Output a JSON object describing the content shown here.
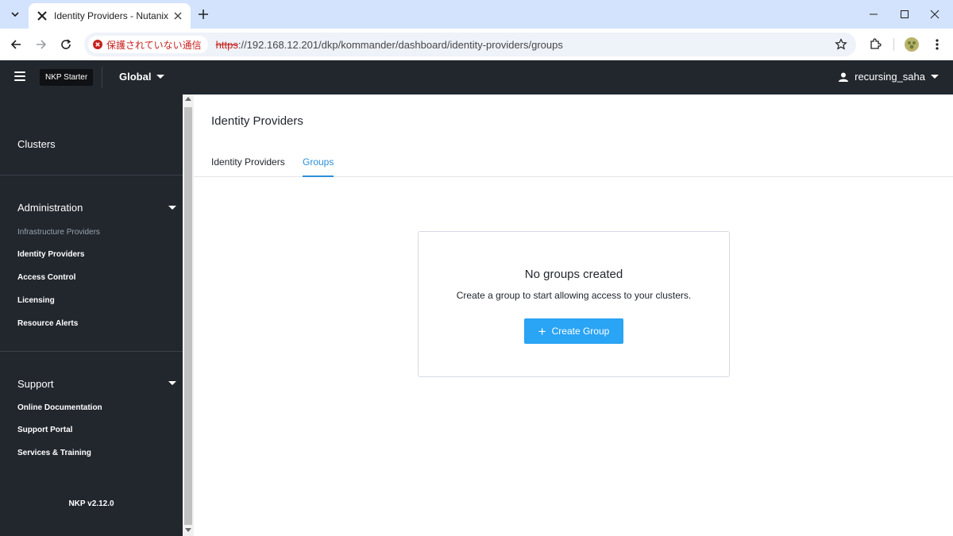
{
  "browser": {
    "tab_title": "Identity Providers - Nutanix NKP",
    "security_label": "保護されていない通信",
    "url_scheme": "https",
    "url_rest": "://192.168.12.201/dkp/kommander/dashboard/identity-providers/groups"
  },
  "header": {
    "brand": "NKP Starter",
    "scope": "Global",
    "username": "recursing_saha"
  },
  "sidebar": {
    "clusters_label": "Clusters",
    "administration": {
      "title": "Administration",
      "items": [
        {
          "label": "Infrastructure Providers"
        },
        {
          "label": "Identity Providers"
        },
        {
          "label": "Access Control"
        },
        {
          "label": "Licensing"
        },
        {
          "label": "Resource Alerts"
        }
      ]
    },
    "support": {
      "title": "Support",
      "items": [
        {
          "label": "Online Documentation"
        },
        {
          "label": "Support Portal"
        },
        {
          "label": "Services & Training"
        }
      ]
    },
    "version": "NKP v2.12.0"
  },
  "main": {
    "title": "Identity Providers",
    "tabs": [
      {
        "label": "Identity Providers",
        "active": false
      },
      {
        "label": "Groups",
        "active": true
      }
    ],
    "empty_state": {
      "title": "No groups created",
      "description": "Create a group to start allowing access to your clusters.",
      "button_label": "Create Group"
    }
  },
  "colors": {
    "accent": "#2d8fd8",
    "button": "#2aa4f4",
    "sidebar_bg": "#22272e"
  }
}
